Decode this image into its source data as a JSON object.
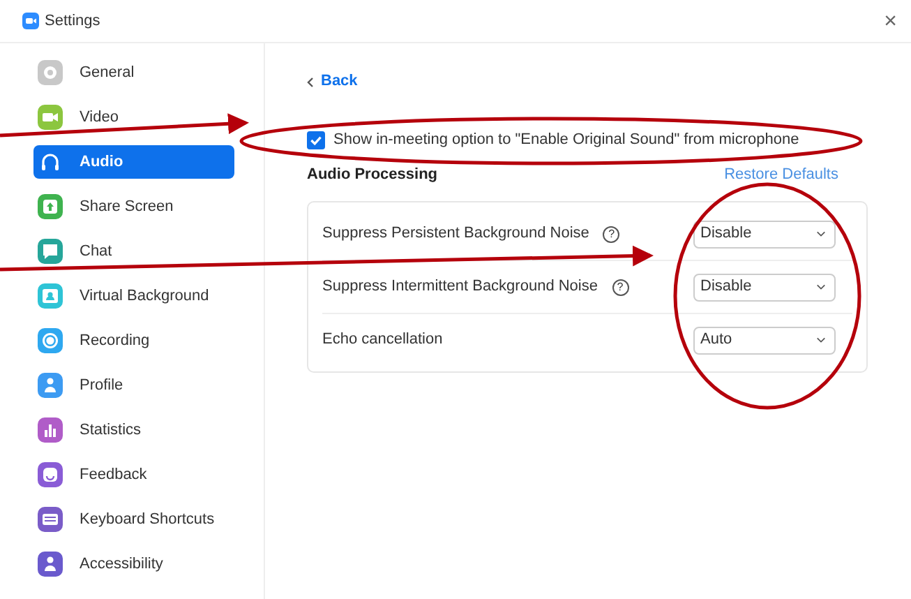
{
  "window": {
    "title": "Settings",
    "close": "×"
  },
  "sidebar": {
    "items": [
      {
        "label": "General",
        "kind": "gear",
        "color": "#c8c8c8",
        "selected": false
      },
      {
        "label": "Video",
        "kind": "camera",
        "color": "#8cc63f",
        "selected": false
      },
      {
        "label": "Audio",
        "kind": "headphones",
        "color": "#0e71eb",
        "selected": true
      },
      {
        "label": "Share Screen",
        "kind": "share",
        "color": "#3fb34f",
        "selected": false
      },
      {
        "label": "Chat",
        "kind": "chat",
        "color": "#26a69a",
        "selected": false
      },
      {
        "label": "Virtual Background",
        "kind": "person-frame",
        "color": "#2ec4d6",
        "selected": false
      },
      {
        "label": "Recording",
        "kind": "record",
        "color": "#2ea8f0",
        "selected": false
      },
      {
        "label": "Profile",
        "kind": "person",
        "color": "#3d9bf2",
        "selected": false
      },
      {
        "label": "Statistics",
        "kind": "bars",
        "color": "#b05cc8",
        "selected": false
      },
      {
        "label": "Feedback",
        "kind": "smile",
        "color": "#8a5cd6",
        "selected": false
      },
      {
        "label": "Keyboard Shortcuts",
        "kind": "keyboard",
        "color": "#7a5cc8",
        "selected": false
      },
      {
        "label": "Accessibility",
        "kind": "person",
        "color": "#6a5acd",
        "selected": false
      }
    ]
  },
  "content": {
    "back": "Back",
    "original_sound": {
      "label": "Show in-meeting option to \"Enable Original Sound\" from microphone",
      "checked": true
    },
    "section_title": "Audio Processing",
    "restore": "Restore Defaults",
    "rows": [
      {
        "label": "Suppress Persistent Background Noise",
        "help": "?",
        "value": "Disable"
      },
      {
        "label": "Suppress Intermittent Background Noise",
        "help": "?",
        "value": "Disable"
      },
      {
        "label": "Echo cancellation",
        "value": "Auto"
      }
    ]
  }
}
